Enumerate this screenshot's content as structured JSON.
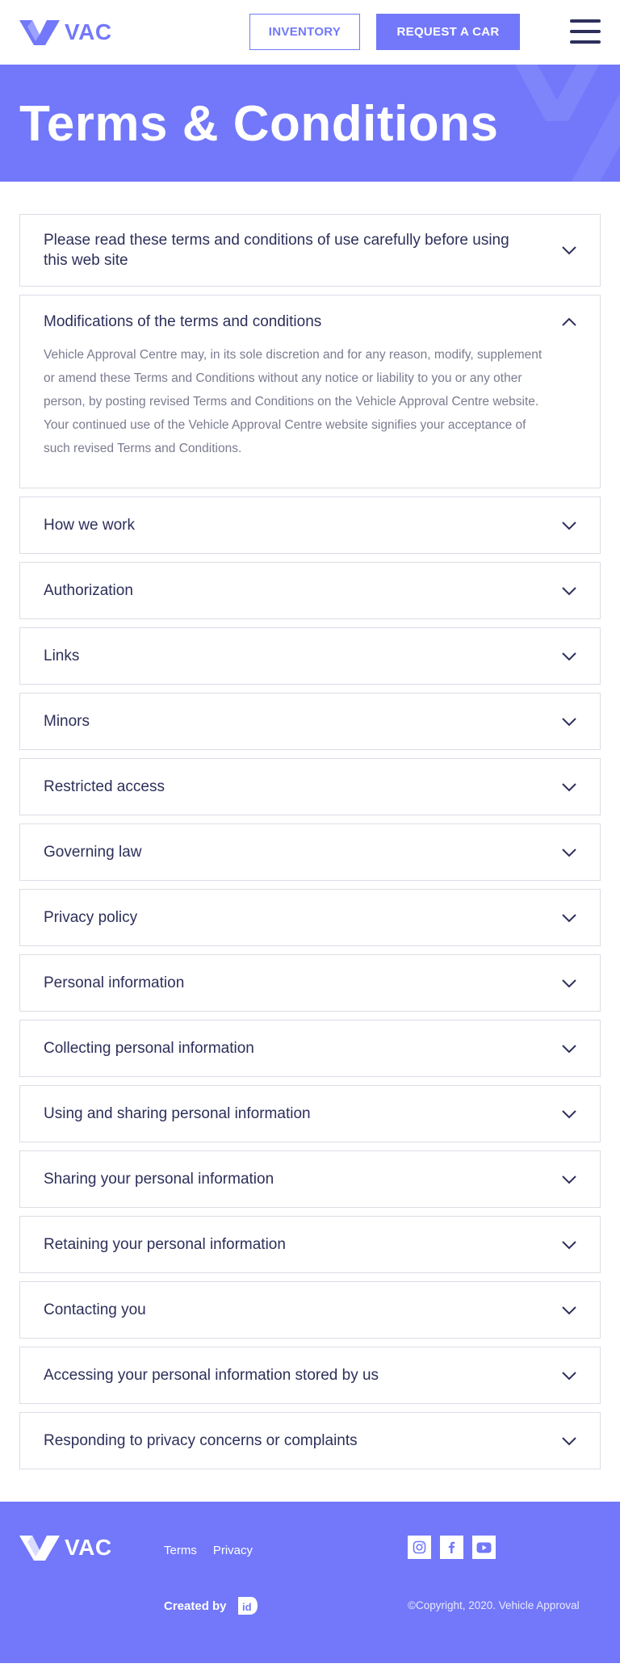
{
  "header": {
    "logo_text": "VAC",
    "inventory_label": "INVENTORY",
    "request_label": "REQUEST A CAR",
    "menu_icon": "hamburger-menu-icon"
  },
  "hero": {
    "title": "Terms & Conditions"
  },
  "accordion": [
    {
      "title": "Please read these terms and conditions of use carefully before using this web site",
      "state": "collapsed"
    },
    {
      "title": "Modifications of the terms and conditions",
      "state": "expanded",
      "body": "Vehicle Approval Centre may, in its sole discretion and for any reason, modify, supplement or amend these Terms and Conditions without any notice or liability to you or any other person, by posting revised Terms and Conditions on the Vehicle Approval Centre website. Your continued use of the Vehicle Approval Centre website signifies your acceptance of such revised Terms and Conditions."
    },
    {
      "title": "How we work",
      "state": "collapsed"
    },
    {
      "title": "Authorization",
      "state": "collapsed"
    },
    {
      "title": "Links",
      "state": "collapsed"
    },
    {
      "title": "Minors",
      "state": "collapsed"
    },
    {
      "title": "Restricted access",
      "state": "collapsed"
    },
    {
      "title": "Governing law",
      "state": "collapsed"
    },
    {
      "title": "Privacy policy",
      "state": "collapsed"
    },
    {
      "title": "Personal information",
      "state": "collapsed"
    },
    {
      "title": "Collecting personal information",
      "state": "collapsed"
    },
    {
      "title": "Using and sharing personal information",
      "state": "collapsed"
    },
    {
      "title": "Sharing your personal information",
      "state": "collapsed"
    },
    {
      "title": "Retaining your personal information",
      "state": "collapsed"
    },
    {
      "title": "Contacting you",
      "state": "collapsed"
    },
    {
      "title": "Accessing your personal information stored by us",
      "state": "collapsed"
    },
    {
      "title": "Responding to privacy concerns or complaints",
      "state": "collapsed"
    }
  ],
  "footer": {
    "logo_text": "VAC",
    "links": {
      "terms": "Terms",
      "privacy": "Privacy"
    },
    "social": [
      "instagram-icon",
      "facebook-icon",
      "youtube-icon"
    ],
    "created_by": "Created by",
    "creator_logo_text": "id",
    "copyright": "©Copyright, 2020. Vehicle Approval"
  },
  "colors": {
    "brand": "#7278f9",
    "text_dark": "#2d2f5a",
    "text_muted": "#7a7c90",
    "border": "#dcdde6"
  }
}
